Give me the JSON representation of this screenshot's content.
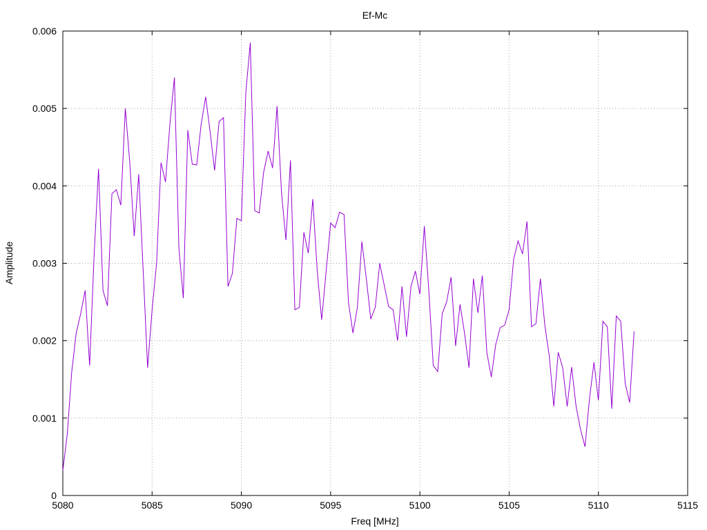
{
  "chart_data": {
    "type": "line",
    "title": "Ef-Mc",
    "xlabel": "Freq [MHz]",
    "ylabel": "Amplitude",
    "xlim": [
      5080,
      5115
    ],
    "ylim": [
      0,
      0.006
    ],
    "xticks": [
      5080,
      5085,
      5090,
      5095,
      5100,
      5105,
      5110,
      5115
    ],
    "xtick_labels": [
      "5080",
      "5085",
      "5090",
      "5095",
      "5100",
      "5105",
      "5110",
      "5115"
    ],
    "yticks": [
      0,
      0.001,
      0.002,
      0.003,
      0.004,
      0.005,
      0.006
    ],
    "ytick_labels": [
      "0",
      "0.001",
      "0.002",
      "0.003",
      "0.004",
      "0.005",
      "0.006"
    ],
    "grid": true,
    "line_color": "#9400d3",
    "series": [
      {
        "x": [
          5080.0,
          5080.25,
          5080.5,
          5080.75,
          5081.0,
          5081.25,
          5081.5,
          5081.75,
          5082.0,
          5082.25,
          5082.5,
          5082.75,
          5083.0,
          5083.25,
          5083.5,
          5083.75,
          5084.0,
          5084.25,
          5084.5,
          5084.75,
          5085.0,
          5085.25,
          5085.5,
          5085.75,
          5086.0,
          5086.25,
          5086.5,
          5086.75,
          5087.0,
          5087.25,
          5087.5,
          5087.75,
          5088.0,
          5088.25,
          5088.5,
          5088.75,
          5089.0,
          5089.25,
          5089.5,
          5089.75,
          5090.0,
          5090.25,
          5090.5,
          5090.75,
          5091.0,
          5091.25,
          5091.5,
          5091.75,
          5092.0,
          5092.25,
          5092.5,
          5092.75,
          5093.0,
          5093.25,
          5093.5,
          5093.75,
          5094.0,
          5094.25,
          5094.5,
          5094.75,
          5095.0,
          5095.25,
          5095.5,
          5095.75,
          5096.0,
          5096.25,
          5096.5,
          5096.75,
          5097.0,
          5097.25,
          5097.5,
          5097.75,
          5098.0,
          5098.25,
          5098.5,
          5098.75,
          5099.0,
          5099.25,
          5099.5,
          5099.75,
          5100.0,
          5100.25,
          5100.5,
          5100.75,
          5101.0,
          5101.25,
          5101.5,
          5101.75,
          5102.0,
          5102.25,
          5102.5,
          5102.75,
          5103.0,
          5103.25,
          5103.5,
          5103.75,
          5104.0,
          5104.25,
          5104.5,
          5104.75,
          5105.0,
          5105.25,
          5105.5,
          5105.75,
          5106.0,
          5106.25,
          5106.5,
          5106.75,
          5107.0,
          5107.25,
          5107.5,
          5107.75,
          5108.0,
          5108.25,
          5108.5,
          5108.75,
          5109.0,
          5109.25,
          5109.5,
          5109.75,
          5110.0,
          5110.25,
          5110.5,
          5110.75,
          5111.0,
          5111.25,
          5111.5,
          5111.75,
          5112.0
        ],
        "y": [
          0.00032,
          0.0008,
          0.0016,
          0.0021,
          0.00235,
          0.00265,
          0.00168,
          0.0031,
          0.00422,
          0.00265,
          0.00245,
          0.0039,
          0.00395,
          0.00375,
          0.005,
          0.0043,
          0.00335,
          0.00415,
          0.0029,
          0.00165,
          0.0024,
          0.003,
          0.0043,
          0.00405,
          0.0048,
          0.0054,
          0.0032,
          0.00255,
          0.00472,
          0.00428,
          0.00427,
          0.0048,
          0.00515,
          0.0047,
          0.0042,
          0.00483,
          0.00488,
          0.0027,
          0.00287,
          0.00358,
          0.00355,
          0.0052,
          0.00585,
          0.00368,
          0.00365,
          0.00418,
          0.00445,
          0.00423,
          0.00503,
          0.0039,
          0.0033,
          0.00433,
          0.0024,
          0.00243,
          0.0034,
          0.00313,
          0.00383,
          0.0029,
          0.00227,
          0.0029,
          0.00352,
          0.00346,
          0.00366,
          0.00363,
          0.0025,
          0.0021,
          0.00243,
          0.00328,
          0.0028,
          0.00228,
          0.00243,
          0.003,
          0.00272,
          0.00244,
          0.0024,
          0.002,
          0.0027,
          0.00205,
          0.0027,
          0.0029,
          0.0026,
          0.00348,
          0.00265,
          0.00168,
          0.0016,
          0.00235,
          0.0025,
          0.00282,
          0.00193,
          0.00247,
          0.0021,
          0.00165,
          0.0028,
          0.00236,
          0.00284,
          0.00185,
          0.00153,
          0.00195,
          0.00217,
          0.0022,
          0.0024,
          0.00305,
          0.00329,
          0.00312,
          0.00354,
          0.00218,
          0.00222,
          0.0028,
          0.0022,
          0.0018,
          0.00115,
          0.00185,
          0.00165,
          0.00115,
          0.00166,
          0.00115,
          0.00085,
          0.00063,
          0.00125,
          0.00172,
          0.00123,
          0.00225,
          0.00218,
          0.00112,
          0.00232,
          0.00225,
          0.00145,
          0.0012,
          0.00212
        ]
      }
    ]
  }
}
